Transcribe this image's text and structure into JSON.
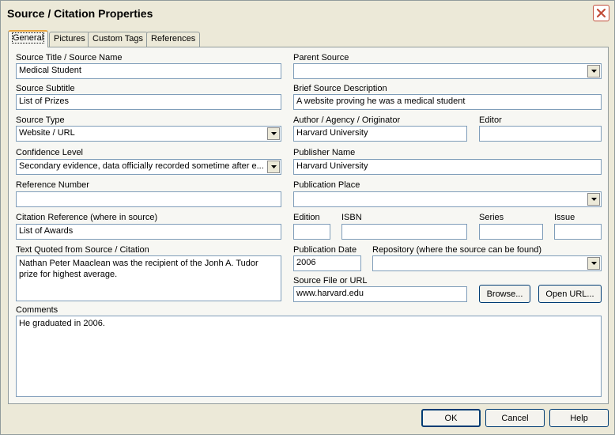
{
  "window": {
    "title": "Source / Citation Properties"
  },
  "tabs": [
    {
      "label": "General"
    },
    {
      "label": "Pictures"
    },
    {
      "label": "Custom Tags"
    },
    {
      "label": "References"
    }
  ],
  "form": {
    "source_title": {
      "label": "Source Title / Source Name",
      "value": "Medical Student"
    },
    "parent_source": {
      "label": "Parent Source",
      "value": ""
    },
    "source_subtitle": {
      "label": "Source Subtitle",
      "value": "List of Prizes"
    },
    "brief_description": {
      "label": "Brief Source Description",
      "value": "A website proving he was a medical student"
    },
    "source_type": {
      "label": "Source Type",
      "value": "Website / URL"
    },
    "author": {
      "label": "Author / Agency / Originator",
      "value": "Harvard University"
    },
    "editor": {
      "label": "Editor",
      "value": ""
    },
    "confidence_level": {
      "label": "Confidence Level",
      "value": "Secondary evidence, data officially recorded sometime after e..."
    },
    "publisher_name": {
      "label": "Publisher Name",
      "value": "Harvard University"
    },
    "reference_number": {
      "label": "Reference Number",
      "value": ""
    },
    "publication_place": {
      "label": "Publication Place",
      "value": ""
    },
    "citation_reference": {
      "label": "Citation Reference (where in source)",
      "value": "List of Awards"
    },
    "edition": {
      "label": "Edition",
      "value": ""
    },
    "isbn": {
      "label": "ISBN",
      "value": ""
    },
    "series": {
      "label": "Series",
      "value": ""
    },
    "issue": {
      "label": "Issue",
      "value": ""
    },
    "text_quoted": {
      "label": "Text Quoted from Source / Citation",
      "value": "Nathan Peter Maaclean was the recipient of the Jonh A. Tudor prize for highest average."
    },
    "publication_date": {
      "label": "Publication Date",
      "value": "2006"
    },
    "repository": {
      "label": "Repository (where the source can be found)",
      "value": ""
    },
    "source_file": {
      "label": "Source File or URL",
      "value": "www.harvard.edu"
    },
    "browse_label": "Browse...",
    "open_url_label": "Open URL...",
    "comments": {
      "label": "Comments",
      "value": "He graduated in 2006."
    }
  },
  "footer": {
    "ok": "OK",
    "cancel": "Cancel",
    "help": "Help"
  },
  "colors": {
    "field_border": "#7f9db9",
    "dialog_bg": "#ece9d8",
    "panel_bg": "#f7f7f3",
    "tab_highlight": "#e7a33c",
    "close_button": "#c24e3a"
  }
}
